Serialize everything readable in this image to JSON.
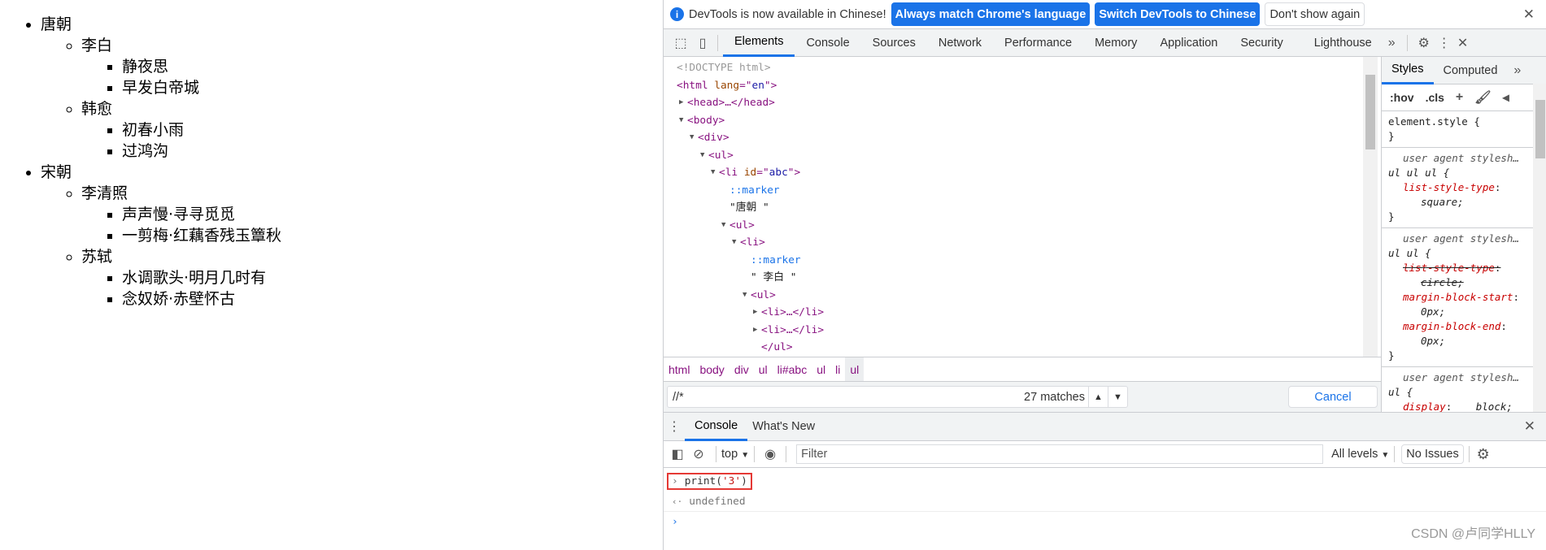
{
  "page": {
    "dynasties": [
      {
        "name": "唐朝",
        "poets": [
          {
            "name": "李白",
            "poems": [
              "静夜思",
              "早发白帝城"
            ]
          },
          {
            "name": "韩愈",
            "poems": [
              "初春小雨",
              "过鸿沟"
            ]
          }
        ]
      },
      {
        "name": "宋朝",
        "poets": [
          {
            "name": "李清照",
            "poems": [
              "声声慢·寻寻觅觅",
              "一剪梅·红藕香残玉簟秋"
            ]
          },
          {
            "name": "苏轼",
            "poems": [
              "水调歌头·明月几时有",
              "念奴娇·赤壁怀古"
            ]
          }
        ]
      }
    ]
  },
  "infobar": {
    "message": "DevTools is now available in Chinese!",
    "btn_match": "Always match Chrome's language",
    "btn_switch": "Switch DevTools to Chinese",
    "btn_dismiss": "Don't show again",
    "close": "✕"
  },
  "tabs": [
    "Elements",
    "Console",
    "Sources",
    "Network",
    "Performance",
    "Memory",
    "Application",
    "Security",
    "Lighthouse"
  ],
  "tabs_more": "»",
  "tree": [
    {
      "indent": 0,
      "arrow": "",
      "tokens": [
        {
          "k": "dc",
          "t": "<!DOCTYPE html>"
        }
      ]
    },
    {
      "indent": 0,
      "arrow": "",
      "tokens": [
        {
          "k": "tg",
          "t": "<html "
        },
        {
          "k": "an",
          "t": "lang"
        },
        {
          "k": "tg",
          "t": "=\""
        },
        {
          "k": "av",
          "t": "en"
        },
        {
          "k": "tg",
          "t": "\">"
        }
      ]
    },
    {
      "indent": 1,
      "arrow": "▶",
      "tokens": [
        {
          "k": "tg",
          "t": "<head>…</head>"
        }
      ]
    },
    {
      "indent": 1,
      "arrow": "▼",
      "tokens": [
        {
          "k": "tg",
          "t": "<body>"
        }
      ]
    },
    {
      "indent": 2,
      "arrow": "▼",
      "tokens": [
        {
          "k": "tg",
          "t": "<div>"
        }
      ]
    },
    {
      "indent": 3,
      "arrow": "▼",
      "tokens": [
        {
          "k": "tg",
          "t": "<ul>"
        }
      ]
    },
    {
      "indent": 4,
      "arrow": "▼",
      "tokens": [
        {
          "k": "tg",
          "t": "<li "
        },
        {
          "k": "an",
          "t": "id"
        },
        {
          "k": "tg",
          "t": "=\""
        },
        {
          "k": "av",
          "t": "abc"
        },
        {
          "k": "tg",
          "t": "\">"
        }
      ]
    },
    {
      "indent": 5,
      "arrow": "",
      "tokens": [
        {
          "k": "ps",
          "t": "::marker"
        }
      ]
    },
    {
      "indent": 5,
      "arrow": "",
      "tokens": [
        {
          "k": "tx",
          "t": "\"唐朝 \""
        }
      ]
    },
    {
      "indent": 5,
      "arrow": "▼",
      "tokens": [
        {
          "k": "tg",
          "t": "<ul>"
        }
      ]
    },
    {
      "indent": 6,
      "arrow": "▼",
      "tokens": [
        {
          "k": "tg",
          "t": "<li>"
        }
      ]
    },
    {
      "indent": 7,
      "arrow": "",
      "tokens": [
        {
          "k": "ps",
          "t": "::marker"
        }
      ]
    },
    {
      "indent": 7,
      "arrow": "",
      "tokens": [
        {
          "k": "tx",
          "t": "\" 李白 \""
        }
      ]
    },
    {
      "indent": 7,
      "arrow": "▼",
      "tokens": [
        {
          "k": "tg",
          "t": "<ul>"
        }
      ]
    },
    {
      "indent": 8,
      "arrow": "▶",
      "tokens": [
        {
          "k": "tg",
          "t": "<li>…</li>"
        }
      ]
    },
    {
      "indent": 8,
      "arrow": "▶",
      "tokens": [
        {
          "k": "tg",
          "t": "<li>…</li>"
        }
      ]
    },
    {
      "indent": 8,
      "arrow": "",
      "tokens": [
        {
          "k": "tg",
          "t": "</ul>"
        }
      ]
    }
  ],
  "breadcrumbs": [
    "html",
    "body",
    "div",
    "ul",
    "li#abc",
    "ul",
    "li",
    "ul"
  ],
  "search": {
    "value": "//*",
    "matches": "27 matches",
    "cancel": "Cancel"
  },
  "styles": {
    "tabs": [
      "Styles",
      "Computed"
    ],
    "more": "»",
    "hov": ":hov",
    "cls": ".cls",
    "rules": [
      {
        "selector": "element.style {",
        "props": []
      },
      {
        "source": "user agent stylesh…",
        "selector": "ul ul ul {",
        "props": [
          {
            "name": "list-style-type",
            "value": "square;",
            "struck": false
          }
        ]
      },
      {
        "source": "user agent stylesh…",
        "selector": "ul ul {",
        "props": [
          {
            "name": "list-style-type",
            "value": "circle;",
            "struck": true
          },
          {
            "name": "margin-block-start",
            "value": "0px;",
            "struck": false
          },
          {
            "name": "margin-block-end",
            "value": "0px;",
            "struck": false
          }
        ]
      },
      {
        "source": "user agent stylesh…",
        "selector": "ul {",
        "props": [
          {
            "name": "display",
            "value": "block;",
            "struck": false
          }
        ]
      }
    ]
  },
  "drawer": {
    "tabs": [
      "Console",
      "What's New"
    ],
    "context": "top",
    "filter_placeholder": "Filter",
    "levels": "All levels",
    "issues": "No Issues"
  },
  "console": {
    "input": "print(",
    "input_str": "'3'",
    "input_end": ")",
    "result": "undefined"
  },
  "watermark": "CSDN @卢同学HLLY"
}
